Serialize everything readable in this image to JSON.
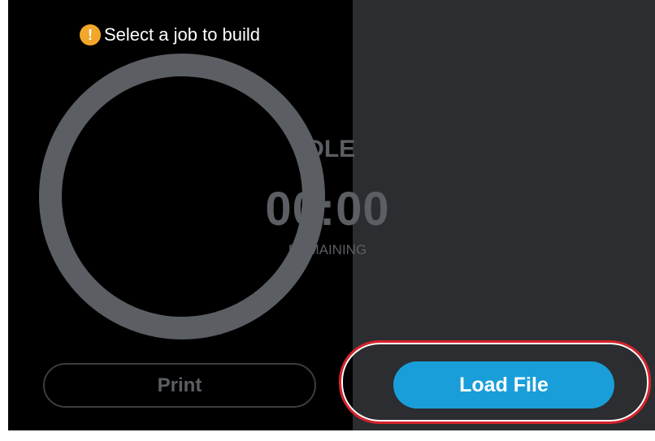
{
  "status": {
    "icon": "warning-icon",
    "icon_glyph": "!",
    "message": "Select a job to build",
    "icon_color": "#f2a72a"
  },
  "timer": {
    "state": "IDLE",
    "time": "00:00",
    "caption": "REMAINING",
    "ring_color": "#5b5e63"
  },
  "buttons": {
    "print_label": "Print",
    "load_file_label": "Load File",
    "load_file_color": "#199ed9",
    "highlight_color": "#d6232b"
  },
  "colors": {
    "left_panel": "#000000",
    "right_panel": "#2c2d30"
  }
}
